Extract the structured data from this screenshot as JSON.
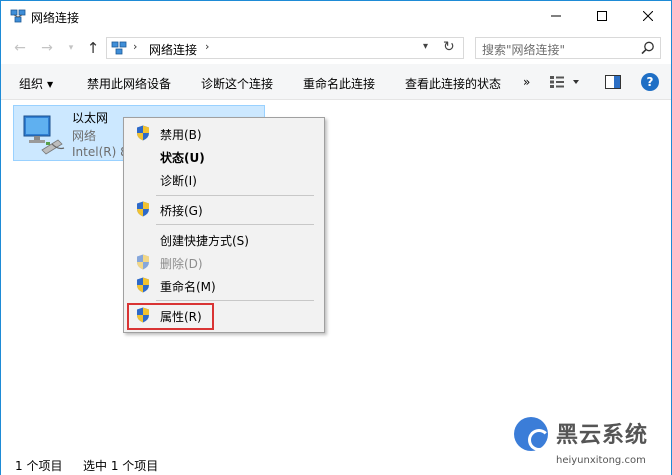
{
  "window": {
    "title": "网络连接",
    "accent": "#1e8bd6"
  },
  "titlebar": {
    "minimize_icon": "minimize-icon",
    "maximize_icon": "maximize-icon",
    "close_icon": "close-icon"
  },
  "nav": {
    "address_path": "网络连接",
    "search_placeholder": "搜索\"网络连接\""
  },
  "commands": {
    "organize": "组织",
    "disable_device": "禁用此网络设备",
    "diagnose": "诊断这个连接",
    "rename": "重命名此连接",
    "view_status": "查看此连接的状态",
    "more": "»",
    "help": "?"
  },
  "connection": {
    "name": "以太网",
    "type": "网络",
    "adapter": "Intel(R) 8"
  },
  "context_menu": {
    "items": [
      {
        "label": "禁用(B)",
        "shield": true
      },
      {
        "label": "状态(U)",
        "bold": true
      },
      {
        "label": "诊断(I)"
      },
      {
        "label": "桥接(G)",
        "shield": true
      },
      {
        "label": "创建快捷方式(S)"
      },
      {
        "label": "删除(D)",
        "shield": true,
        "disabled": true
      },
      {
        "label": "重命名(M)",
        "shield": true
      },
      {
        "label": "属性(R)",
        "shield": true,
        "highlighted": true
      }
    ]
  },
  "statusbar": {
    "item_count": "1 个项目",
    "selected": "选中 1 个项目"
  },
  "watermark": {
    "brand": "黑云系统",
    "url": "heiyunxitong.com"
  },
  "colors": {
    "selection_bg": "#cce8ff",
    "highlight_border": "#d93434",
    "help_blue": "#1f6fc5"
  }
}
